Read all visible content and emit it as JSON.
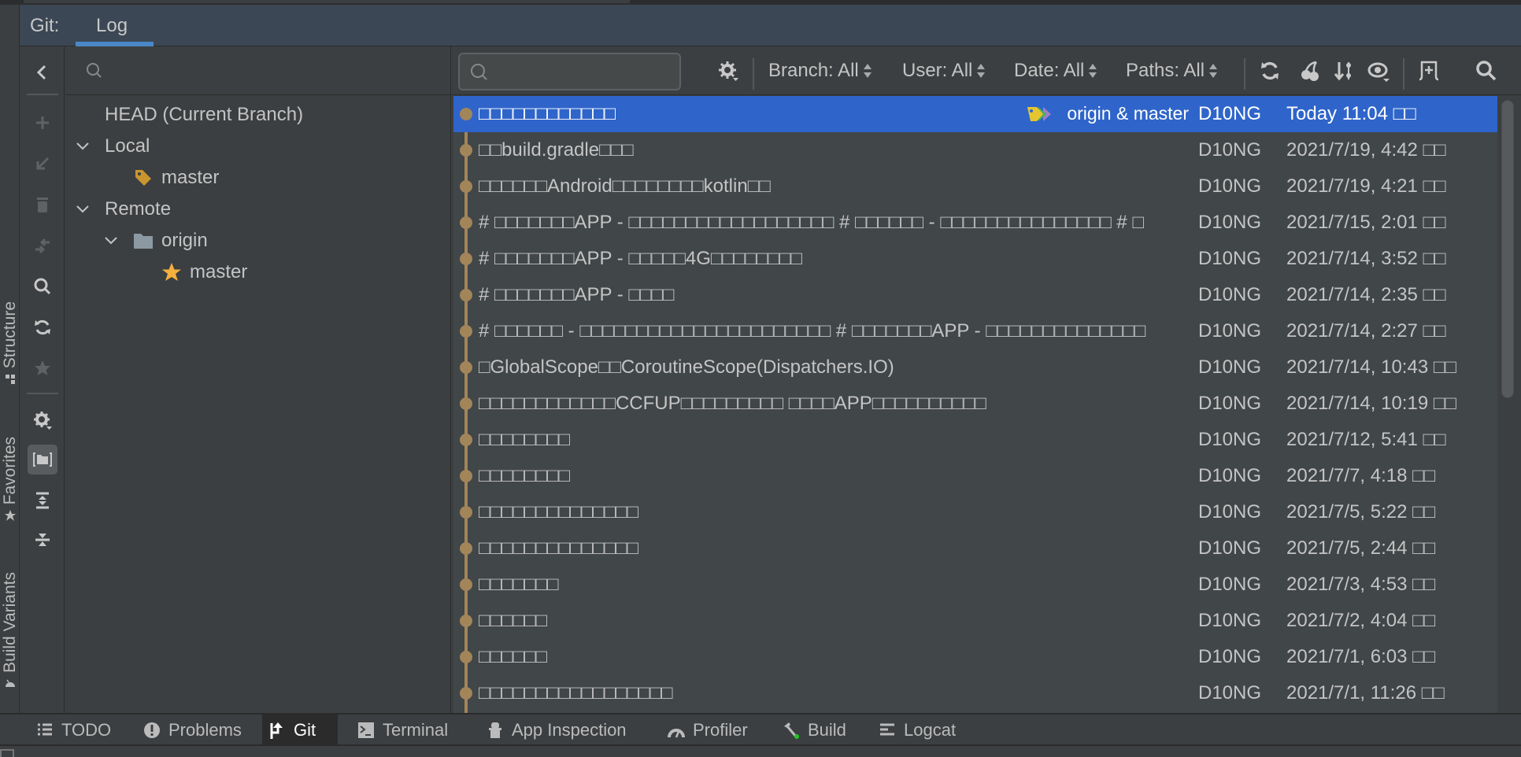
{
  "tool_window": {
    "prefix": "Git:",
    "tabs": [
      {
        "label": "Log",
        "active": true
      }
    ]
  },
  "stripe": {
    "labels": [
      "Structure",
      "Favorites",
      "Build Variants"
    ]
  },
  "actions": {
    "items": [
      "back",
      "new-branch",
      "update-selected",
      "delete-branch",
      "compare",
      "search",
      "fetch",
      "favorite",
      "settings",
      "group-by-directory",
      "expand-all",
      "collapse-all"
    ],
    "active": "group-by-directory"
  },
  "branch_tree": {
    "search_placeholder": "",
    "search_value": "",
    "nodes": [
      {
        "label": "HEAD (Current Branch)",
        "level": 0,
        "expandable": false,
        "icon": ""
      },
      {
        "label": "Local",
        "level": 0,
        "expandable": true,
        "expanded": true,
        "icon": ""
      },
      {
        "label": "master",
        "level": 1,
        "expandable": false,
        "icon": "tag-icon"
      },
      {
        "label": "Remote",
        "level": 0,
        "expandable": true,
        "expanded": true,
        "icon": ""
      },
      {
        "label": "origin",
        "level": 1,
        "expandable": true,
        "expanded": true,
        "icon": "folder-icon"
      },
      {
        "label": "master",
        "level": 2,
        "expandable": false,
        "icon": "star-icon"
      }
    ]
  },
  "log": {
    "search_placeholder": "",
    "search_value": "",
    "filters": [
      {
        "label": "Branch: All"
      },
      {
        "label": "User: All"
      },
      {
        "label": "Date: All"
      },
      {
        "label": "Paths: All"
      }
    ],
    "colors": {
      "selection": "#2f65ca",
      "graph": "#a3855a",
      "tag_yellow": "#e5c630",
      "tag_green": "#4caf50",
      "tag_purple": "#9b7fc8"
    },
    "commits": [
      {
        "message": "□□□□□□□□□□□□",
        "refs": "origin & master",
        "author": "D10NG",
        "date": "Today 11:04 □□",
        "selected": true
      },
      {
        "message": "□□build.gradle□□□",
        "refs": "",
        "author": "D10NG",
        "date": "2021/7/19, 4:42 □□"
      },
      {
        "message": "□□□□□□Android□□□□□□□□kotlin□□",
        "refs": "",
        "author": "D10NG",
        "date": "2021/7/19, 4:21 □□"
      },
      {
        "message": "# □□□□□□□APP - □□□□□□□□□□□□□□□□□□ # □□□□□□ - □□□□□□□□□□□□□□□ # □",
        "refs": "",
        "author": "D10NG",
        "date": "2021/7/15, 2:01 □□"
      },
      {
        "message": "# □□□□□□□APP - □□□□□4G□□□□□□□□",
        "refs": "",
        "author": "D10NG",
        "date": "2021/7/14, 3:52 □□"
      },
      {
        "message": "# □□□□□□□APP - □□□□",
        "refs": "",
        "author": "D10NG",
        "date": "2021/7/14, 2:35 □□"
      },
      {
        "message": "# □□□□□□ - □□□□□□□□□□□□□□□□□□□□□□ # □□□□□□□APP - □□□□□□□□□□□□□□",
        "refs": "",
        "author": "D10NG",
        "date": "2021/7/14, 2:27 □□"
      },
      {
        "message": "□GlobalScope□□CoroutineScope(Dispatchers.IO)",
        "refs": "",
        "author": "D10NG",
        "date": "2021/7/14, 10:43 □□"
      },
      {
        "message": "□□□□□□□□□□□□CCFUP□□□□□□□□□ □□□□APP□□□□□□□□□□",
        "refs": "",
        "author": "D10NG",
        "date": "2021/7/14, 10:19 □□"
      },
      {
        "message": "□□□□□□□□",
        "refs": "",
        "author": "D10NG",
        "date": "2021/7/12, 5:41 □□"
      },
      {
        "message": "□□□□□□□□",
        "refs": "",
        "author": "D10NG",
        "date": "2021/7/7, 4:18 □□"
      },
      {
        "message": "□□□□□□□□□□□□□□",
        "refs": "",
        "author": "D10NG",
        "date": "2021/7/5, 5:22 □□"
      },
      {
        "message": "□□□□□□□□□□□□□□",
        "refs": "",
        "author": "D10NG",
        "date": "2021/7/5, 2:44 □□"
      },
      {
        "message": "□□□□□□□",
        "refs": "",
        "author": "D10NG",
        "date": "2021/7/3, 4:53 □□"
      },
      {
        "message": "□□□□□□",
        "refs": "",
        "author": "D10NG",
        "date": "2021/7/2, 4:04 □□"
      },
      {
        "message": "□□□□□□",
        "refs": "",
        "author": "D10NG",
        "date": "2021/7/1, 6:03 □□"
      },
      {
        "message": "□□□□□□□□□□□□□□□□□",
        "refs": "",
        "author": "D10NG",
        "date": "2021/7/1, 11:26 □□"
      }
    ],
    "scroll_position": 0,
    "scroll_visible_fraction": 0.49
  },
  "bottom_tabs": [
    {
      "label": "TODO",
      "icon": "list-icon"
    },
    {
      "label": "Problems",
      "icon": "problems-icon"
    },
    {
      "label": "Git",
      "icon": "git-branch-icon",
      "active": true
    },
    {
      "label": "Terminal",
      "icon": "terminal-icon"
    },
    {
      "label": "App Inspection",
      "icon": "app-inspection-icon"
    },
    {
      "label": "Profiler",
      "icon": "profiler-icon"
    },
    {
      "label": "Build",
      "icon": "build-hammer-icon"
    },
    {
      "label": "Logcat",
      "icon": "logcat-icon"
    }
  ],
  "build_status_color": "#22c722"
}
